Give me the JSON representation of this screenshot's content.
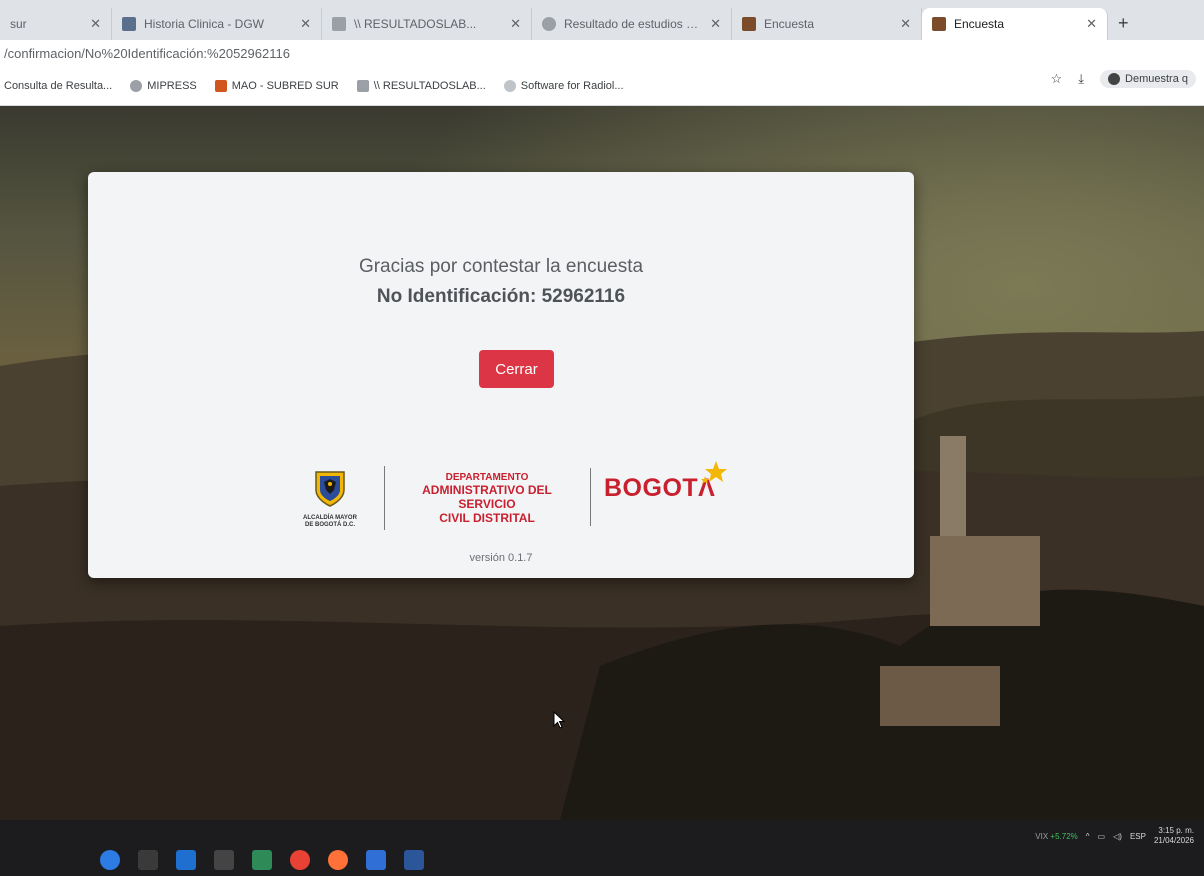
{
  "browser": {
    "tabs": [
      {
        "title": "sur",
        "active": false
      },
      {
        "title": "Historia Clinica - DGW",
        "active": false
      },
      {
        "title": "\\\\ RESULTADOSLAB...",
        "active": false
      },
      {
        "title": "Resultado de estudios clínicos",
        "active": false
      },
      {
        "title": "Encuesta",
        "active": false
      },
      {
        "title": "Encuesta",
        "active": true
      }
    ],
    "new_tab": "+",
    "url": "/confirmacion/No%20Identificación:%2052962116",
    "bookmarks": [
      {
        "label": "Consulta de Resulta..."
      },
      {
        "label": "MIPRESS"
      },
      {
        "label": "MAO - SUBRED SUR"
      },
      {
        "label": "\\\\ RESULTADOSLAB..."
      },
      {
        "label": "Software for Radiol..."
      }
    ],
    "profile_label": "Demuestra q"
  },
  "modal": {
    "message": "Gracias por contestar la encuesta",
    "identification_label": "No Identificación: 52962116",
    "close_button": "Cerrar",
    "version": "versión 0.1.7"
  },
  "taskbar": {
    "ticker_name": "VIX",
    "ticker_change": "+5.72%",
    "language": "ESP",
    "time": "3:15 p. m.",
    "date": "21/04/2026"
  },
  "colors": {
    "primary_red": "#dc3545",
    "brand_red": "#c8202f",
    "brand_gold": "#f2b705"
  }
}
